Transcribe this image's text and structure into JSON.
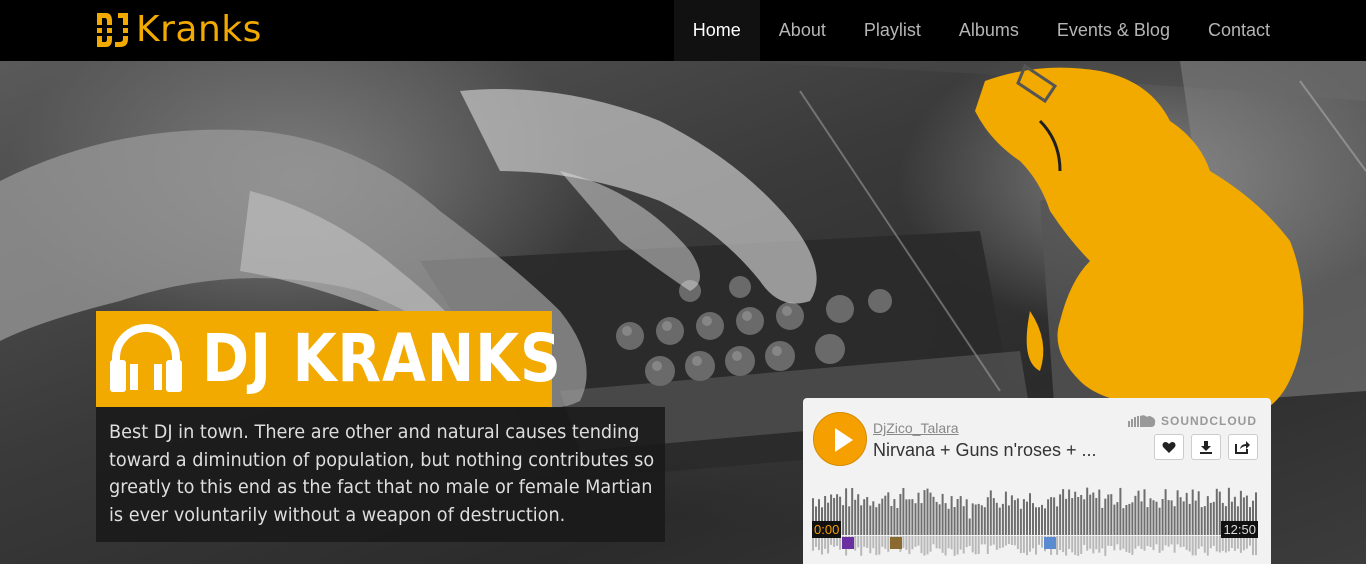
{
  "brand": {
    "name": "Kranks",
    "mark": "DJ"
  },
  "nav": {
    "items": [
      {
        "label": "Home",
        "active": true
      },
      {
        "label": "About",
        "active": false
      },
      {
        "label": "Playlist",
        "active": false
      },
      {
        "label": "Albums",
        "active": false
      },
      {
        "label": "Events & Blog",
        "active": false
      },
      {
        "label": "Contact",
        "active": false
      }
    ]
  },
  "hero": {
    "title": "DJ KRANKS",
    "description": "Best DJ in town. There are other and natural causes tending toward a diminution of population, but nothing contributes so greatly to this end as the fact that no male or female Martian is ever voluntarily without a weapon of destruction."
  },
  "player": {
    "user": "DjZico_Talara",
    "track": "Nirvana + Guns n'roses + ...",
    "brand": "SOUNDCLOUD",
    "time_current": "0:00",
    "time_total": "12:50",
    "accent": "#f5a000"
  },
  "colors": {
    "accent": "#f2a900",
    "nav_bg": "#000000"
  }
}
